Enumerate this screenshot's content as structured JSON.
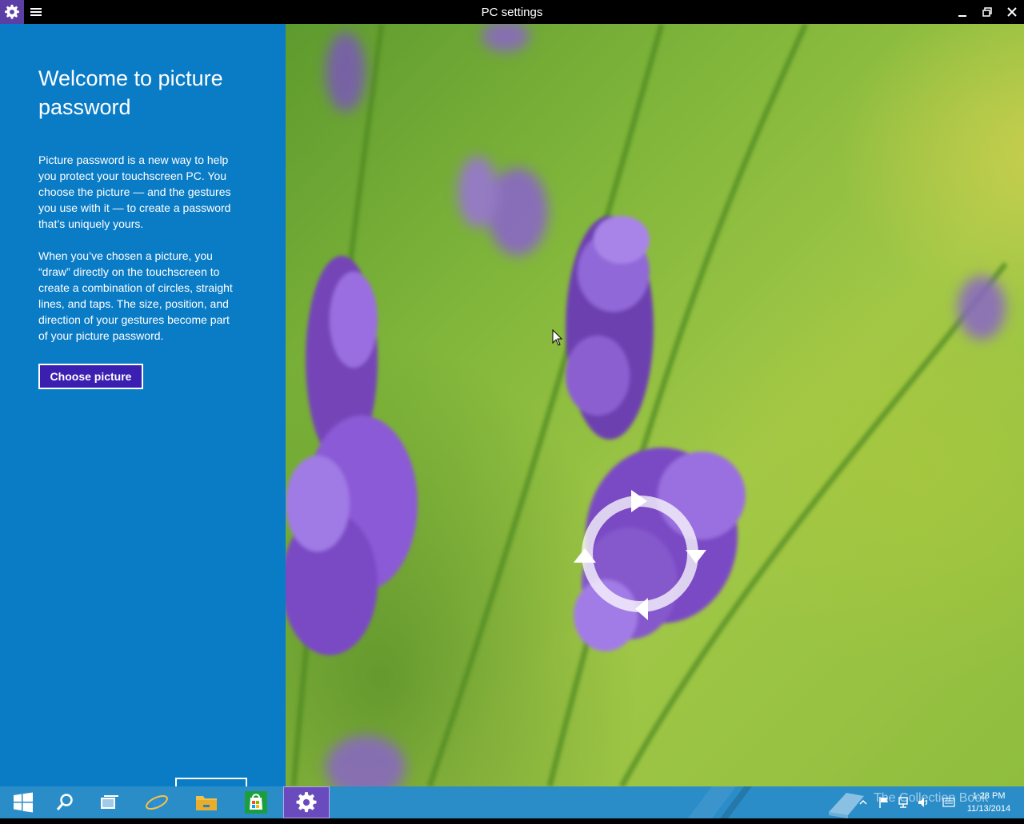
{
  "window": {
    "title": "PC settings",
    "icons": {
      "app": "gear-icon",
      "menu": "hamburger-icon",
      "minimize": "minimize-icon",
      "maximize": "restore-icon",
      "close": "close-icon"
    }
  },
  "panel": {
    "heading": "Welcome to picture password",
    "paragraph1": "Picture password is a new way to help you protect your touchscreen PC. You choose the picture — and the gestures you use with it — to create a password that’s uniquely yours.",
    "paragraph2": "When you’ve chosen a picture, you “draw” directly on the touchscreen to create a combination of circles, straight lines, and taps. The size, position, and direction of your gestures become part of your picture password.",
    "choose_button": "Choose picture",
    "background_color": "#0a7cc6",
    "button_color": "#3a1fb0"
  },
  "taskbar": {
    "items": [
      "start-icon",
      "search-icon",
      "task-view-icon",
      "internet-explorer-icon",
      "file-explorer-icon",
      "store-icon",
      "pc-settings-icon"
    ],
    "active_item": "pc-settings-icon",
    "watermark": "The Collection Book",
    "clock": {
      "time": "1:28 PM",
      "date": "11/13/2014"
    },
    "background_color": "#2b8dc8"
  }
}
